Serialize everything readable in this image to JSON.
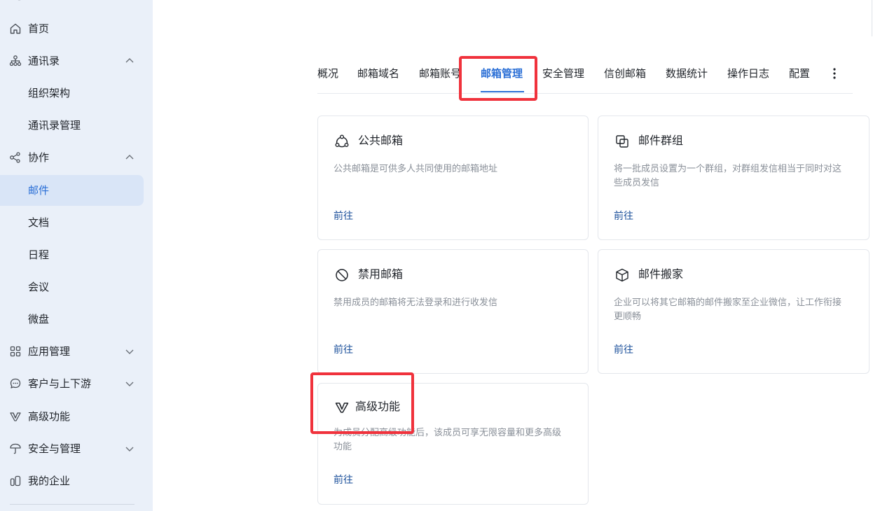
{
  "sidebar": {
    "items": [
      {
        "label": "首页",
        "icon": "home-icon"
      },
      {
        "label": "通讯录",
        "icon": "org-chart-icon",
        "expanded": true
      },
      {
        "label": "组织架构"
      },
      {
        "label": "通讯录管理"
      },
      {
        "label": "协作",
        "icon": "collaboration-icon",
        "expanded": true
      },
      {
        "label": "邮件",
        "active": true
      },
      {
        "label": "文档"
      },
      {
        "label": "日程"
      },
      {
        "label": "会议"
      },
      {
        "label": "微盘"
      },
      {
        "label": "应用管理",
        "icon": "apps-grid-icon",
        "expanded": false
      },
      {
        "label": "客户与上下游",
        "icon": "chat-bubble-icon",
        "expanded": false
      },
      {
        "label": "高级功能",
        "icon": "v-badge-icon"
      },
      {
        "label": "安全与管理",
        "icon": "umbrella-icon",
        "expanded": false
      },
      {
        "label": "我的企业",
        "icon": "enterprise-icon"
      }
    ]
  },
  "tabs": [
    {
      "label": "概况"
    },
    {
      "label": "邮箱域名"
    },
    {
      "label": "邮箱账号"
    },
    {
      "label": "邮箱管理",
      "active": true
    },
    {
      "label": "安全管理"
    },
    {
      "label": "信创邮箱"
    },
    {
      "label": "数据统计"
    },
    {
      "label": "操作日志"
    },
    {
      "label": "配置"
    }
  ],
  "cards": [
    {
      "title": "公共邮箱",
      "desc": "公共邮箱是可供多人共同使用的邮箱地址",
      "link": "前往",
      "icon": "shared-mailbox-icon"
    },
    {
      "title": "邮件群组",
      "desc": "将一批成员设置为一个群组，对群组发信相当于同时对这些成员发信",
      "link": "前往",
      "icon": "mail-group-icon"
    },
    {
      "title": "禁用邮箱",
      "desc": "禁用成员的邮箱将无法登录和进行收发信",
      "link": "前往",
      "icon": "ban-icon"
    },
    {
      "title": "邮件搬家",
      "desc": "企业可以将其它邮箱的邮件搬家至企业微信，让工作衔接更顺畅",
      "link": "前往",
      "icon": "box-icon"
    },
    {
      "title": "高级功能",
      "desc": "为成员分配高级功能后，该成员可享无限容量和更多高级功能",
      "link": "前往",
      "icon": "v-badge-icon"
    }
  ],
  "colors": {
    "accent": "#2b6fd6",
    "highlight": "#f0323c",
    "sidebar_bg": "#eaf0f9",
    "link": "#1a4f9a"
  }
}
